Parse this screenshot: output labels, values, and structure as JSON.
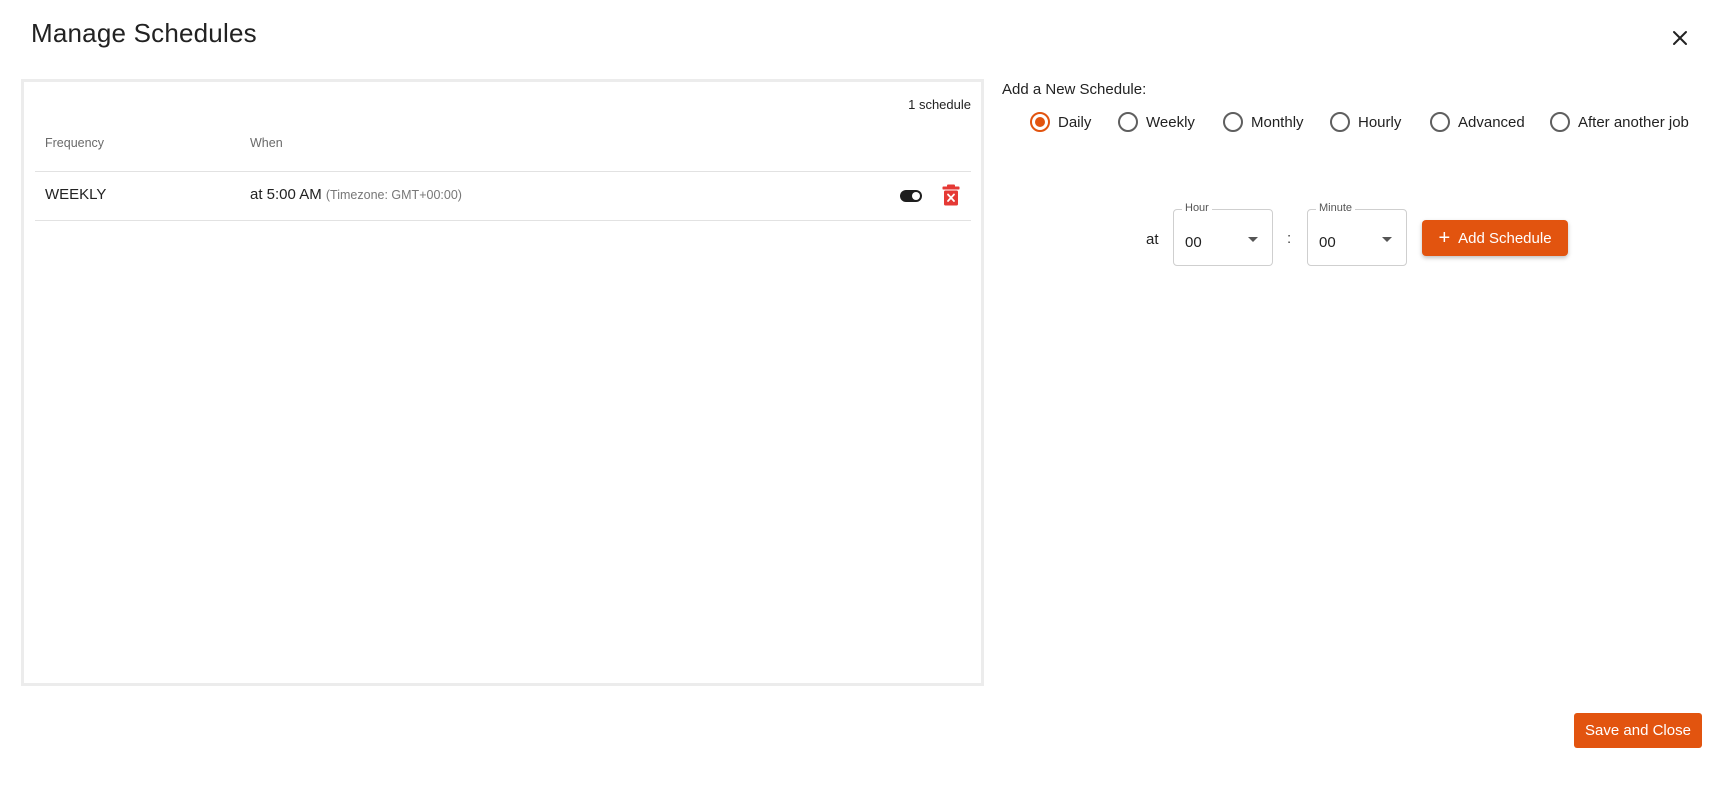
{
  "dialog": {
    "title": "Manage Schedules"
  },
  "schedules": {
    "count_label": "1 schedule",
    "columns": [
      "Frequency",
      "When"
    ],
    "rows": [
      {
        "frequency": "WEEKLY",
        "when": "at 5:00 AM",
        "timezone": "(Timezone: GMT+00:00)",
        "enabled": true
      }
    ]
  },
  "new_schedule": {
    "label": "Add a New Schedule:",
    "options": [
      "Daily",
      "Weekly",
      "Monthly",
      "Hourly",
      "Advanced",
      "After another job"
    ],
    "selected": "Daily",
    "at_label": "at",
    "hour": {
      "legend": "Hour",
      "value": "00"
    },
    "separator": ":",
    "minute": {
      "legend": "Minute",
      "value": "00"
    },
    "add_button": "Add Schedule"
  },
  "footer": {
    "save_button": "Save and Close"
  },
  "colors": {
    "accent": "#e2540f",
    "danger": "#e53935"
  }
}
